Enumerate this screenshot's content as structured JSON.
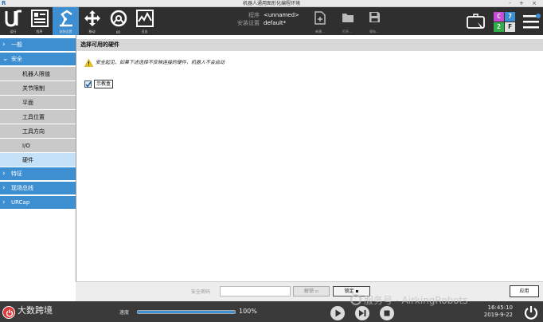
{
  "window": {
    "logo": "R",
    "title": "机器人通用图形化编程环境",
    "controls": "- + ×"
  },
  "toolbar": {
    "buttons": [
      {
        "name": "run",
        "label": "运行",
        "icon": "ur-logo-icon"
      },
      {
        "name": "program",
        "label": "程序",
        "icon": "program-icon"
      },
      {
        "name": "installation",
        "label": "安装设置",
        "icon": "installation-icon",
        "active": true
      },
      {
        "name": "move",
        "label": "移动",
        "icon": "move-icon"
      },
      {
        "name": "io",
        "label": "I/O",
        "icon": "io-icon"
      },
      {
        "name": "log",
        "label": "日志",
        "icon": "log-icon"
      }
    ],
    "program_label": "程序",
    "program_value": "<unnamed>",
    "installation_label": "安装设置",
    "installation_value": "default*",
    "file_buttons": [
      {
        "label": "新建...",
        "icon": "new-file-icon"
      },
      {
        "label": "打开...",
        "icon": "folder-icon"
      },
      {
        "label": "保存...",
        "icon": "save-icon"
      }
    ],
    "badges": {
      "c": "C",
      "c_num": "7",
      "two": "2",
      "f": "F"
    }
  },
  "sidebar": {
    "sections": [
      {
        "label": "一般",
        "expanded": false
      },
      {
        "label": "安全",
        "expanded": true
      },
      {
        "label": "特征",
        "expanded": false
      },
      {
        "label": "现场总线",
        "expanded": false
      },
      {
        "label": "URCap",
        "expanded": false
      }
    ],
    "safety_items": [
      {
        "label": "机器人限值"
      },
      {
        "label": "关节限制"
      },
      {
        "label": "平面"
      },
      {
        "label": "工具位置"
      },
      {
        "label": "工具方向"
      },
      {
        "label": "I/O"
      },
      {
        "label": "硬件",
        "selected": true
      }
    ]
  },
  "main": {
    "header": "选择可用的硬件",
    "warning": "安全起见，如果下述选择不反映连接的硬件，机器人不会启动",
    "checkbox_label": "示教盒",
    "checkbox_checked": true
  },
  "bottom_bar": {
    "password_label": "安全密码",
    "password_value": "",
    "unlock_label": "解锁",
    "lock_label": "锁定",
    "apply_label": "应用"
  },
  "footer": {
    "brand": "大数跨境",
    "speed_label": "速度",
    "speed_percent": "100%",
    "speed_value": 1.0,
    "time": "16:45:10",
    "date": "2019-9-22"
  },
  "watermark": "服务号 · AirkingRobots",
  "colors": {
    "accent": "#3d8fd1",
    "toolbar_bg": "#2f2f2f",
    "sidebar_item_bg": "#c9c9c9",
    "sidebar_selected_bg": "#c4e1f7",
    "warning_yellow": "#f2c811",
    "badge_c": "#c74bd6",
    "badge_7": "#3d8fd1",
    "badge_2": "#2fae4a",
    "badge_f": "#e0e0e0"
  }
}
